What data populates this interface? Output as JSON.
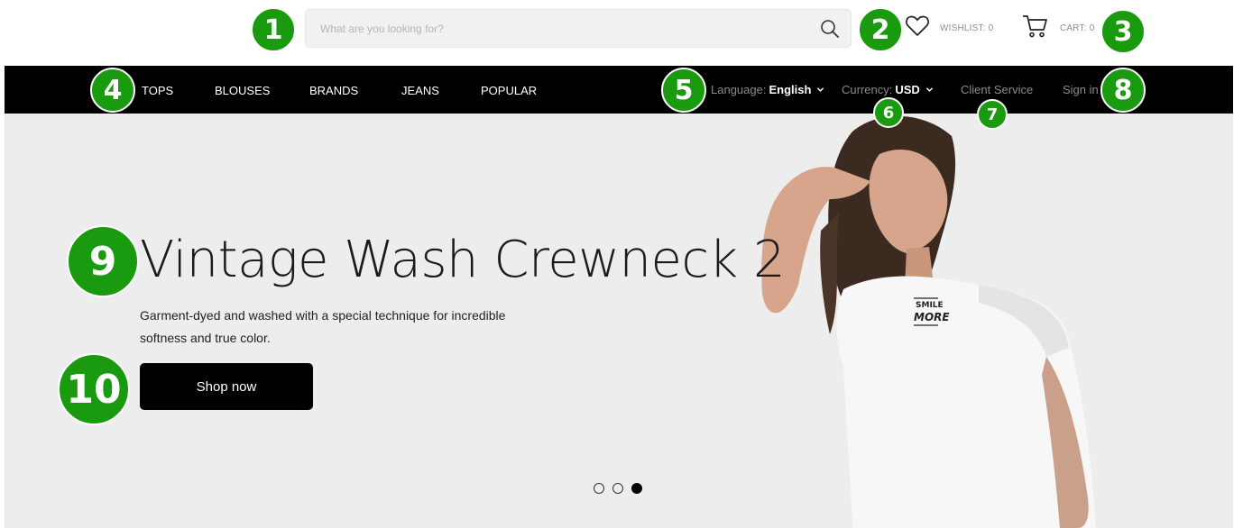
{
  "header": {
    "search": {
      "placeholder": "What are you looking for?",
      "value": ""
    },
    "wishlist": {
      "label": "WISHLIST: 0",
      "icon": "heart-icon"
    },
    "cart": {
      "label": "CART: 0",
      "icon": "cart-icon"
    }
  },
  "nav": {
    "links": [
      "TOPS",
      "BLOUSES",
      "BRANDS",
      "JEANS",
      "POPULAR"
    ],
    "language": {
      "label": "Language:",
      "value": "English"
    },
    "currency": {
      "label": "Currency:",
      "value": "USD"
    },
    "client_service": "Client Service",
    "sign_in": "Sign in"
  },
  "hero": {
    "title": "Vintage Wash Crewneck 2",
    "description": "Garment-dyed and washed with a special technique for incredible softness and true color.",
    "cta": "Shop now",
    "slides": 3,
    "active_slide": 3,
    "shirt_text": [
      "SMILE",
      "MORE"
    ]
  },
  "markers": [
    "1",
    "2",
    "3",
    "4",
    "5",
    "6",
    "7",
    "8",
    "9",
    "10"
  ],
  "colors": {
    "marker": "#1a9a0e",
    "navbar": "#000000",
    "hero_bg": "#ededed"
  }
}
